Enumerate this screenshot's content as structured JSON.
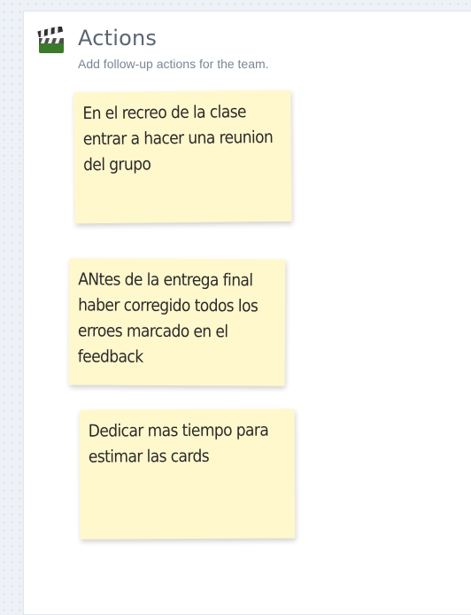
{
  "section": {
    "icon": "clapperboard-icon",
    "title": "Actions",
    "subtitle": "Add follow-up actions for the team."
  },
  "notes": [
    {
      "text": "En el recreo de la clase entrar a hacer una reunion del grupo"
    },
    {
      "text": "ANtes de la entrega final haber corregido todos los erroes marcado en el feedback"
    },
    {
      "text": "Dedicar mas tiempo para estimar las cards"
    }
  ],
  "colors": {
    "note_background": "#fff8cd",
    "title": "#5b6572",
    "subtitle": "#7a8794",
    "page_background": "#eef2f7"
  }
}
